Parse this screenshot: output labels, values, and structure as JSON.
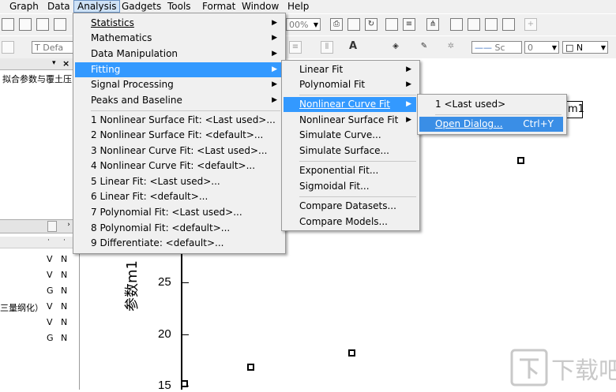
{
  "menubar": {
    "items": [
      "Graph",
      "Data",
      "Analysis",
      "Gadgets",
      "Tools",
      "Format",
      "Window",
      "Help"
    ]
  },
  "toolbar": {
    "zoom_value": "00%",
    "font_value": "Defa",
    "line_width_value": "0",
    "size_value": "N",
    "line_style_label": "Sc"
  },
  "left_panel": {
    "title": "拟合参数与覆土压",
    "lower_rows": [
      {
        "label": "",
        "c1": "V",
        "c2": "N"
      },
      {
        "label": "",
        "c1": "V",
        "c2": "N"
      },
      {
        "label": "",
        "c1": "G",
        "c2": "N"
      },
      {
        "label": "三量纲化）",
        "c1": "V",
        "c2": "N"
      },
      {
        "label": "",
        "c1": "V",
        "c2": "N"
      },
      {
        "label": "",
        "c1": "G",
        "c2": "N"
      }
    ]
  },
  "graph": {
    "y_title": "参数m1",
    "y_ticks": [
      "25",
      "20",
      "15"
    ],
    "legend_text": "m1"
  },
  "analysis_menu": {
    "items": [
      {
        "label": "Statistics",
        "submenu": true
      },
      {
        "label": "Mathematics",
        "submenu": true
      },
      {
        "label": "Data Manipulation",
        "submenu": true
      },
      {
        "label": "Fitting",
        "submenu": true
      },
      {
        "label": "Signal Processing",
        "submenu": true
      },
      {
        "label": "Peaks and Baseline",
        "submenu": true
      },
      {
        "label": "1 Nonlinear Surface Fit: <Last used>..."
      },
      {
        "label": "2 Nonlinear Surface Fit: <default>..."
      },
      {
        "label": "3 Nonlinear Curve Fit: <Last used>..."
      },
      {
        "label": "4 Nonlinear Curve Fit: <default>..."
      },
      {
        "label": "5 Linear Fit: <Last used>..."
      },
      {
        "label": "6 Linear Fit: <default>..."
      },
      {
        "label": "7 Polynomial Fit: <Last used>..."
      },
      {
        "label": "8 Polynomial Fit: <default>..."
      },
      {
        "label": "9 Differentiate: <default>..."
      }
    ]
  },
  "fitting_menu": {
    "items": [
      {
        "label": "Linear Fit",
        "submenu": true
      },
      {
        "label": "Polynomial Fit",
        "submenu": true
      },
      {
        "label": "Nonlinear Curve Fit",
        "submenu": true
      },
      {
        "label": "Nonlinear Surface Fit",
        "submenu": true
      },
      {
        "label": "Simulate Curve..."
      },
      {
        "label": "Simulate Surface..."
      },
      {
        "label": "Exponential Fit..."
      },
      {
        "label": "Sigmoidal Fit..."
      },
      {
        "label": "Compare Datasets..."
      },
      {
        "label": "Compare Models..."
      }
    ]
  },
  "nlfit_menu": {
    "items": [
      {
        "label": "1 <Last used>"
      },
      {
        "label": "Open Dialog...",
        "accel": "Ctrl+Y"
      }
    ]
  },
  "watermark": {
    "text": "下载吧"
  },
  "colors": {
    "highlight": "#3399ff",
    "menu_bg": "#f0f0f0"
  }
}
